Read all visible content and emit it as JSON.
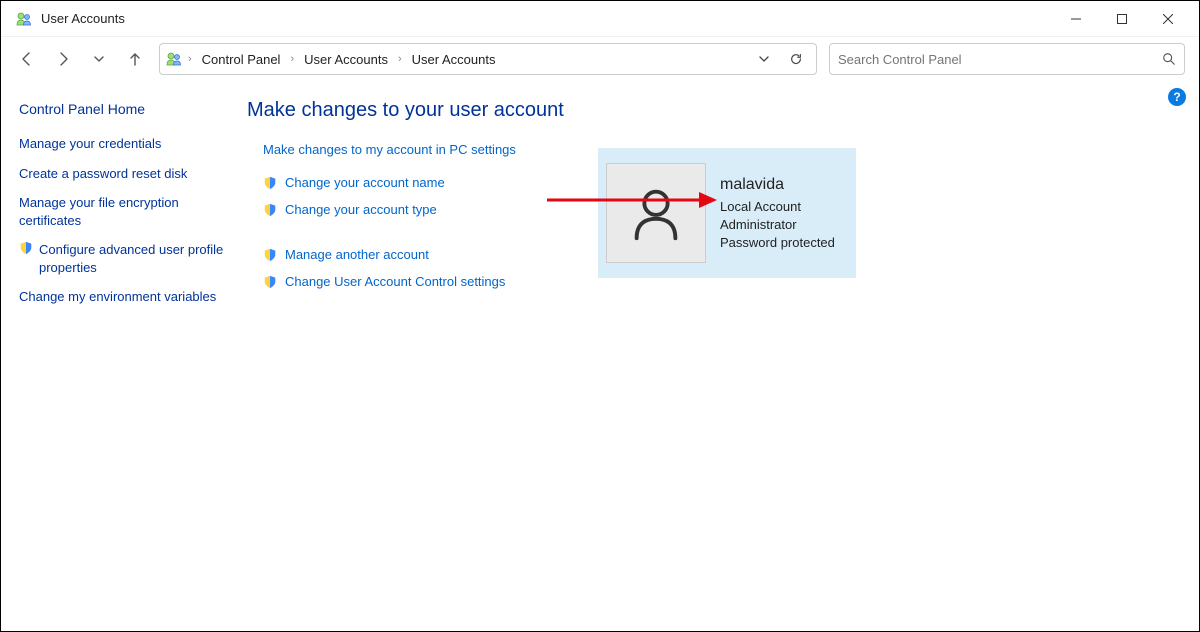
{
  "window": {
    "title": "User Accounts"
  },
  "breadcrumbs": {
    "root": "Control Panel",
    "level1": "User Accounts",
    "level2": "User Accounts"
  },
  "search": {
    "placeholder": "Search Control Panel"
  },
  "sidebar": {
    "home": "Control Panel Home",
    "items": [
      {
        "label": "Manage your credentials",
        "shield": false
      },
      {
        "label": "Create a password reset disk",
        "shield": false
      },
      {
        "label": "Manage your file encryption certificates",
        "shield": false
      },
      {
        "label": "Configure advanced user profile properties",
        "shield": true
      },
      {
        "label": "Change my environment variables",
        "shield": false
      }
    ]
  },
  "main": {
    "title": "Make changes to your user account",
    "actions": {
      "pc_settings": "Make changes to my account in PC settings",
      "change_name": "Change your account name",
      "change_type": "Change your account type",
      "manage_another": "Manage another account",
      "uac_settings": "Change User Account Control settings"
    }
  },
  "user": {
    "name": "malavida",
    "line1": "Local Account",
    "line2": "Administrator",
    "line3": "Password protected"
  }
}
